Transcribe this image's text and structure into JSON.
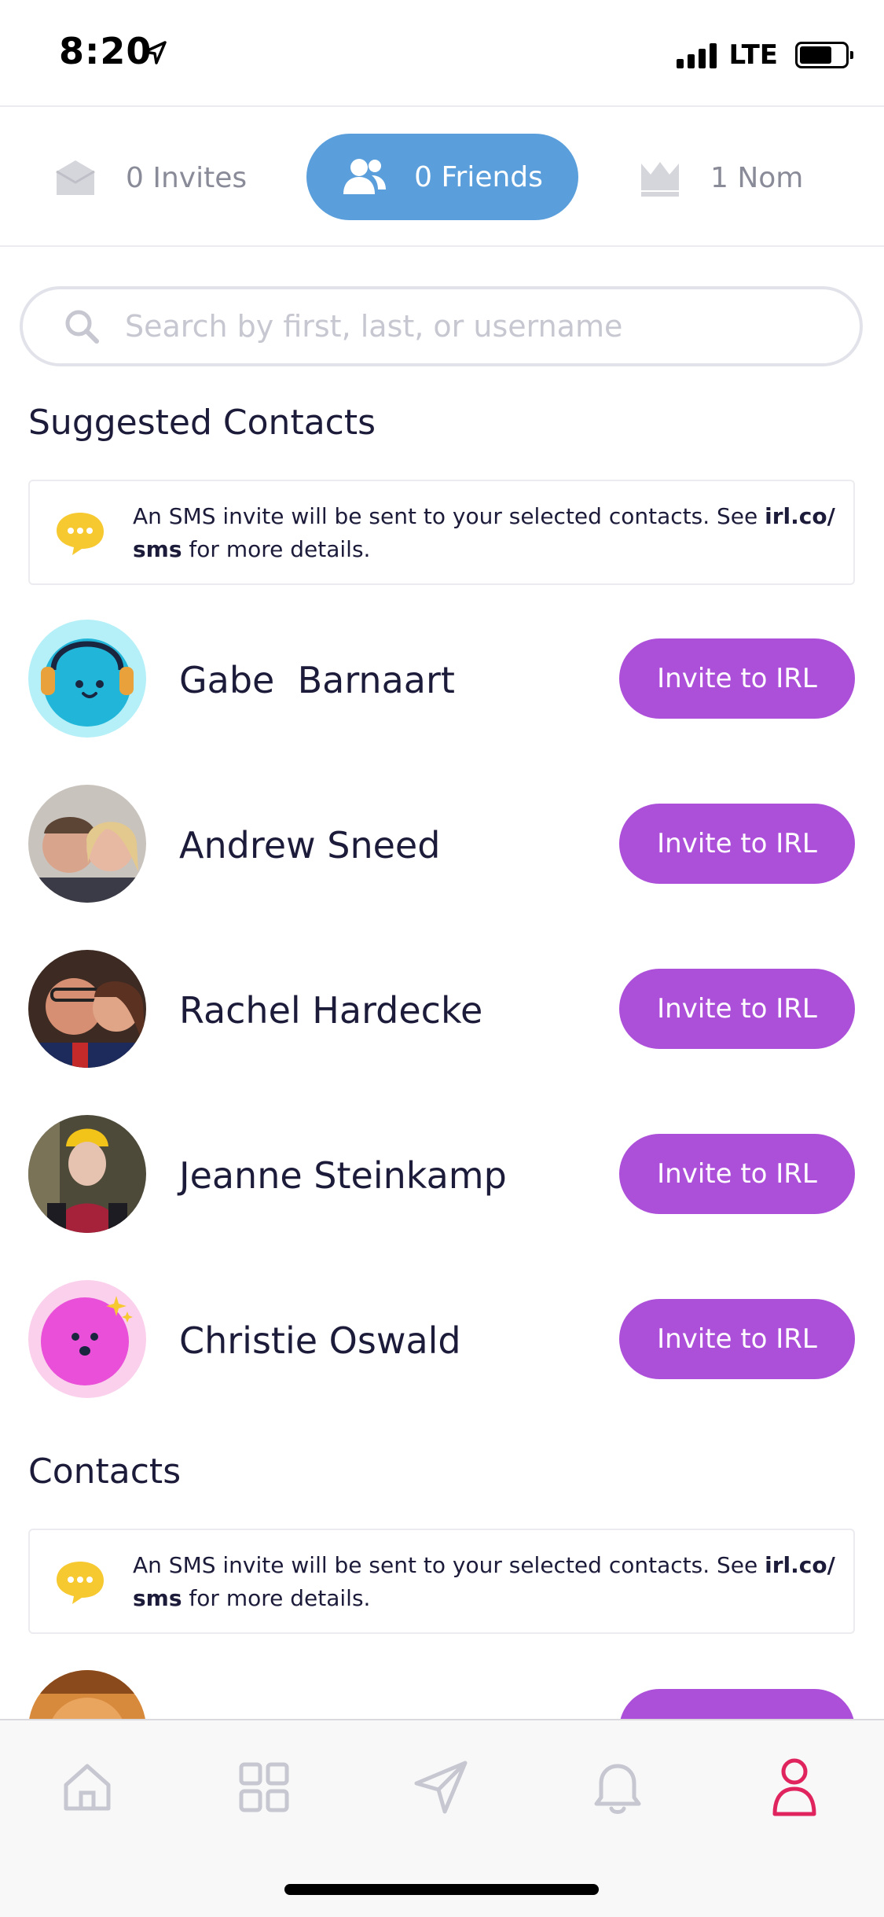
{
  "status_bar": {
    "time": "8:20",
    "network": "LTE"
  },
  "tabs": [
    {
      "label": "0 Invites",
      "icon": "envelope-icon",
      "active": false
    },
    {
      "label": "0 Friends",
      "icon": "people-icon",
      "active": true
    },
    {
      "label": "1 Nom",
      "icon": "crown-icon",
      "active": false
    }
  ],
  "search": {
    "placeholder": "Search by first, last, or username",
    "value": ""
  },
  "suggested": {
    "title": "Suggested Contacts",
    "notice": {
      "text_pre": "An SMS invite will be sent to your selected contacts. See ",
      "link": "irl.co/ sms",
      "text_post": " for more details."
    },
    "contacts": [
      {
        "name": "Gabe  Barnaart",
        "button": "Invite to IRL",
        "avatar": "headphones-blob"
      },
      {
        "name": "Andrew Sneed",
        "button": "Invite to IRL",
        "avatar": "photo"
      },
      {
        "name": "Rachel Hardecke",
        "button": "Invite to IRL",
        "avatar": "photo"
      },
      {
        "name": "Jeanne Steinkamp",
        "button": "Invite to IRL",
        "avatar": "photo"
      },
      {
        "name": "Christie Oswald",
        "button": "Invite to IRL",
        "avatar": "pink-blob"
      }
    ]
  },
  "contacts_section": {
    "title": "Contacts",
    "notice": {
      "text_pre": "An SMS invite will be sent to your selected contacts. See ",
      "link": "irl.co/ sms",
      "text_post": " for more details."
    }
  },
  "bottom_nav": [
    {
      "icon": "home-icon",
      "active": false
    },
    {
      "icon": "grid-icon",
      "active": false
    },
    {
      "icon": "send-icon",
      "active": false
    },
    {
      "icon": "bell-icon",
      "active": false
    },
    {
      "icon": "profile-icon",
      "active": true
    }
  ],
  "colors": {
    "accent_blue": "#5a9fdb",
    "invite_purple": "#ac4fd9",
    "active_nav": "#e0245e",
    "text": "#1c1b3a",
    "notice_icon": "#f7c931"
  }
}
